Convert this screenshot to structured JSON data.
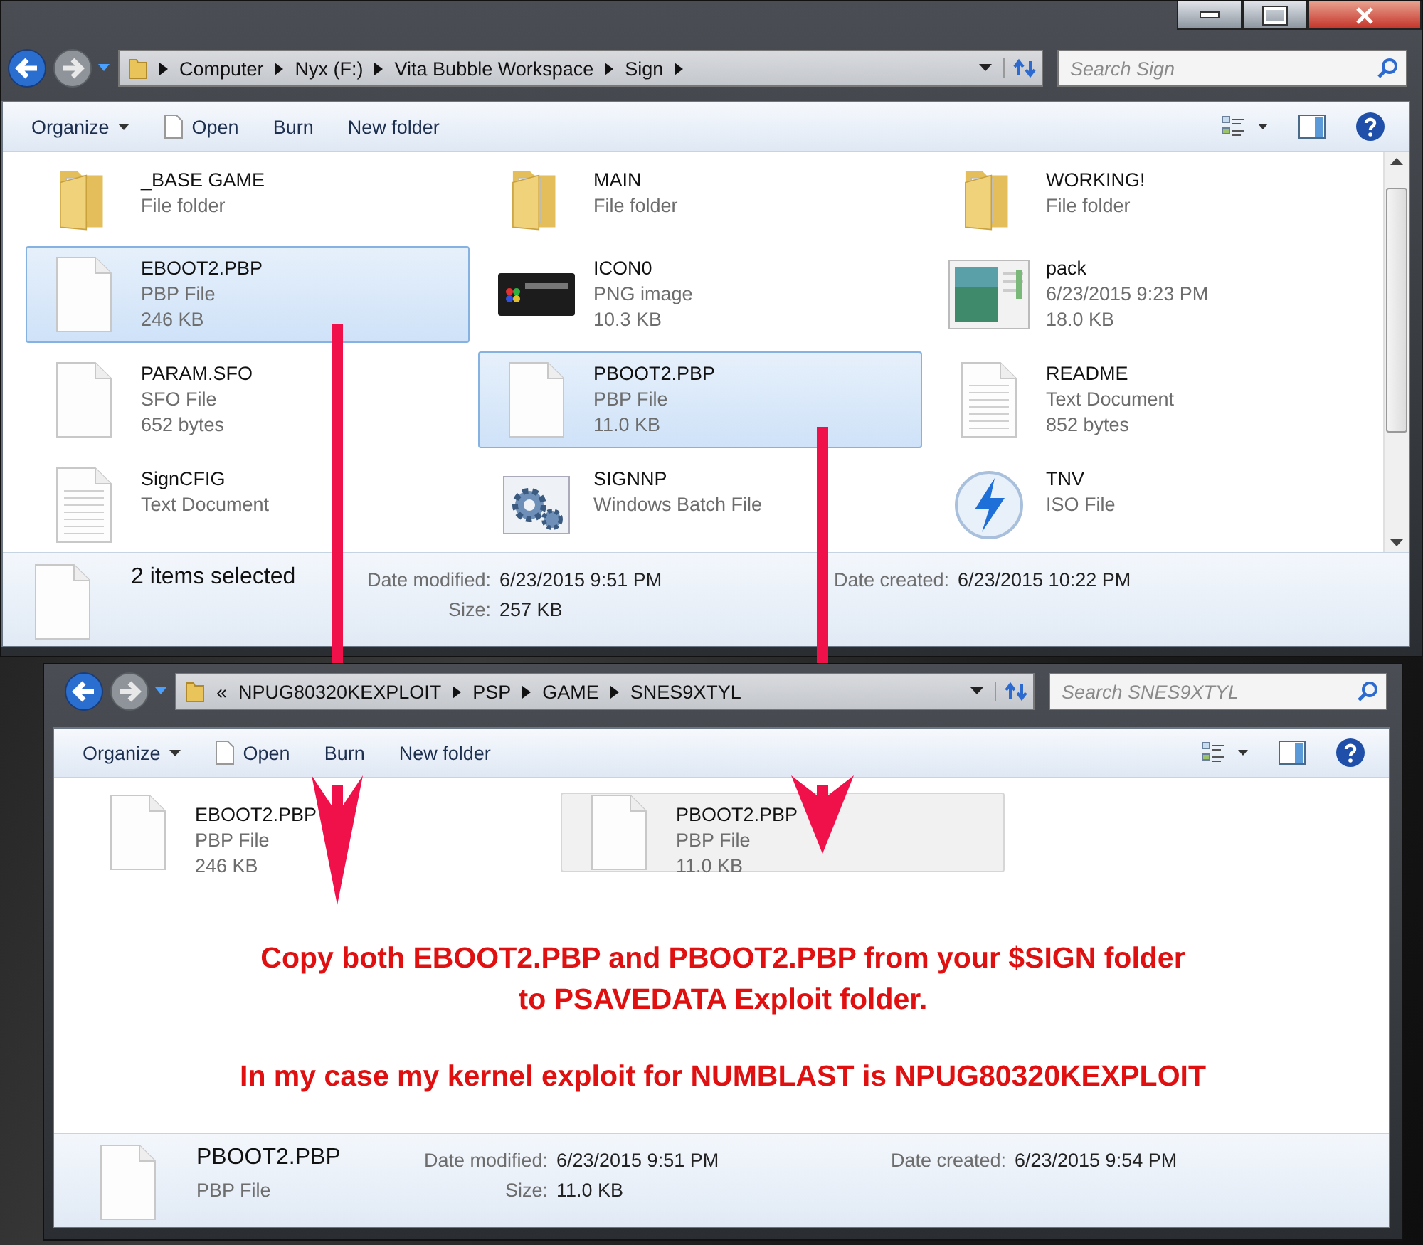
{
  "window_1": {
    "address": {
      "crumbs": [
        "Computer",
        "Nyx (F:)",
        "Vita Bubble Workspace",
        "Sign"
      ]
    },
    "search": {
      "placeholder": "Search Sign"
    },
    "toolbar": [
      {
        "label": "Organize",
        "kind": "menu"
      },
      {
        "label": "Open",
        "kind": "file"
      },
      {
        "label": "Burn",
        "kind": "plain"
      },
      {
        "label": "New folder",
        "kind": "plain"
      }
    ],
    "files": [
      {
        "name": "_BASE GAME",
        "lines": [
          "File folder"
        ],
        "kind": "folder",
        "selected": false
      },
      {
        "name": "MAIN",
        "lines": [
          "File folder"
        ],
        "kind": "folder",
        "selected": false
      },
      {
        "name": "WORKING!",
        "lines": [
          "File folder"
        ],
        "kind": "folder",
        "selected": false
      },
      {
        "name": "EBOOT2.PBP",
        "lines": [
          "PBP File",
          "246 KB"
        ],
        "kind": "file",
        "selected": true
      },
      {
        "name": "ICON0",
        "lines": [
          "PNG image",
          "10.3 KB"
        ],
        "kind": "image",
        "selected": false
      },
      {
        "name": "pack",
        "lines": [
          "6/23/2015 9:23 PM",
          "18.0 KB"
        ],
        "kind": "thumb",
        "selected": false
      },
      {
        "name": "PARAM.SFO",
        "lines": [
          "SFO File",
          "652 bytes"
        ],
        "kind": "file",
        "selected": false
      },
      {
        "name": "PBOOT2.PBP",
        "lines": [
          "PBP File",
          "11.0 KB"
        ],
        "kind": "file",
        "selected": true
      },
      {
        "name": "README",
        "lines": [
          "Text Document",
          "852 bytes"
        ],
        "kind": "text",
        "selected": false
      },
      {
        "name": "SignCFIG",
        "lines": [
          "Text Document"
        ],
        "kind": "text",
        "selected": false
      },
      {
        "name": "SIGNNP",
        "lines": [
          "Windows Batch File"
        ],
        "kind": "batch",
        "selected": false
      },
      {
        "name": "TNV",
        "lines": [
          "ISO File"
        ],
        "kind": "iso",
        "selected": false
      }
    ],
    "details": {
      "title": "2 items selected",
      "fields": [
        {
          "label": "Date modified:",
          "value": "6/23/2015 9:51 PM"
        },
        {
          "label": "Date created:",
          "value": "6/23/2015 10:22 PM"
        },
        {
          "label": "Size:",
          "value": "257 KB"
        }
      ]
    }
  },
  "window_2": {
    "address": {
      "overflow": "«",
      "crumbs": [
        "NPUG80320KEXPLOIT",
        "PSP",
        "GAME",
        "SNES9XTYL"
      ]
    },
    "search": {
      "placeholder": "Search SNES9XTYL"
    },
    "toolbar": [
      {
        "label": "Organize",
        "kind": "menu"
      },
      {
        "label": "Open",
        "kind": "file"
      },
      {
        "label": "Burn",
        "kind": "plain"
      },
      {
        "label": "New folder",
        "kind": "plain"
      }
    ],
    "files": [
      {
        "name": "EBOOT2.PBP",
        "lines": [
          "PBP File",
          "246 KB"
        ],
        "kind": "file",
        "selected": false
      },
      {
        "name": "PBOOT2.PBP",
        "lines": [
          "PBP File",
          "11.0 KB"
        ],
        "kind": "file",
        "selected": true
      }
    ],
    "details": {
      "title": "PBOOT2.PBP",
      "subtitle": "PBP File",
      "fields": [
        {
          "label": "Date modified:",
          "value": "6/23/2015 9:51 PM"
        },
        {
          "label": "Date created:",
          "value": "6/23/2015 9:54 PM"
        },
        {
          "label": "Size:",
          "value": "11.0 KB"
        }
      ]
    }
  },
  "annotation": [
    "Copy both EBOOT2.PBP and PBOOT2.PBP from your $SIGN folder",
    "to PSAVEDATA Exploit folder.",
    "In my case my kernel exploit for NUMBLAST is NPUG80320KEXPLOIT"
  ]
}
